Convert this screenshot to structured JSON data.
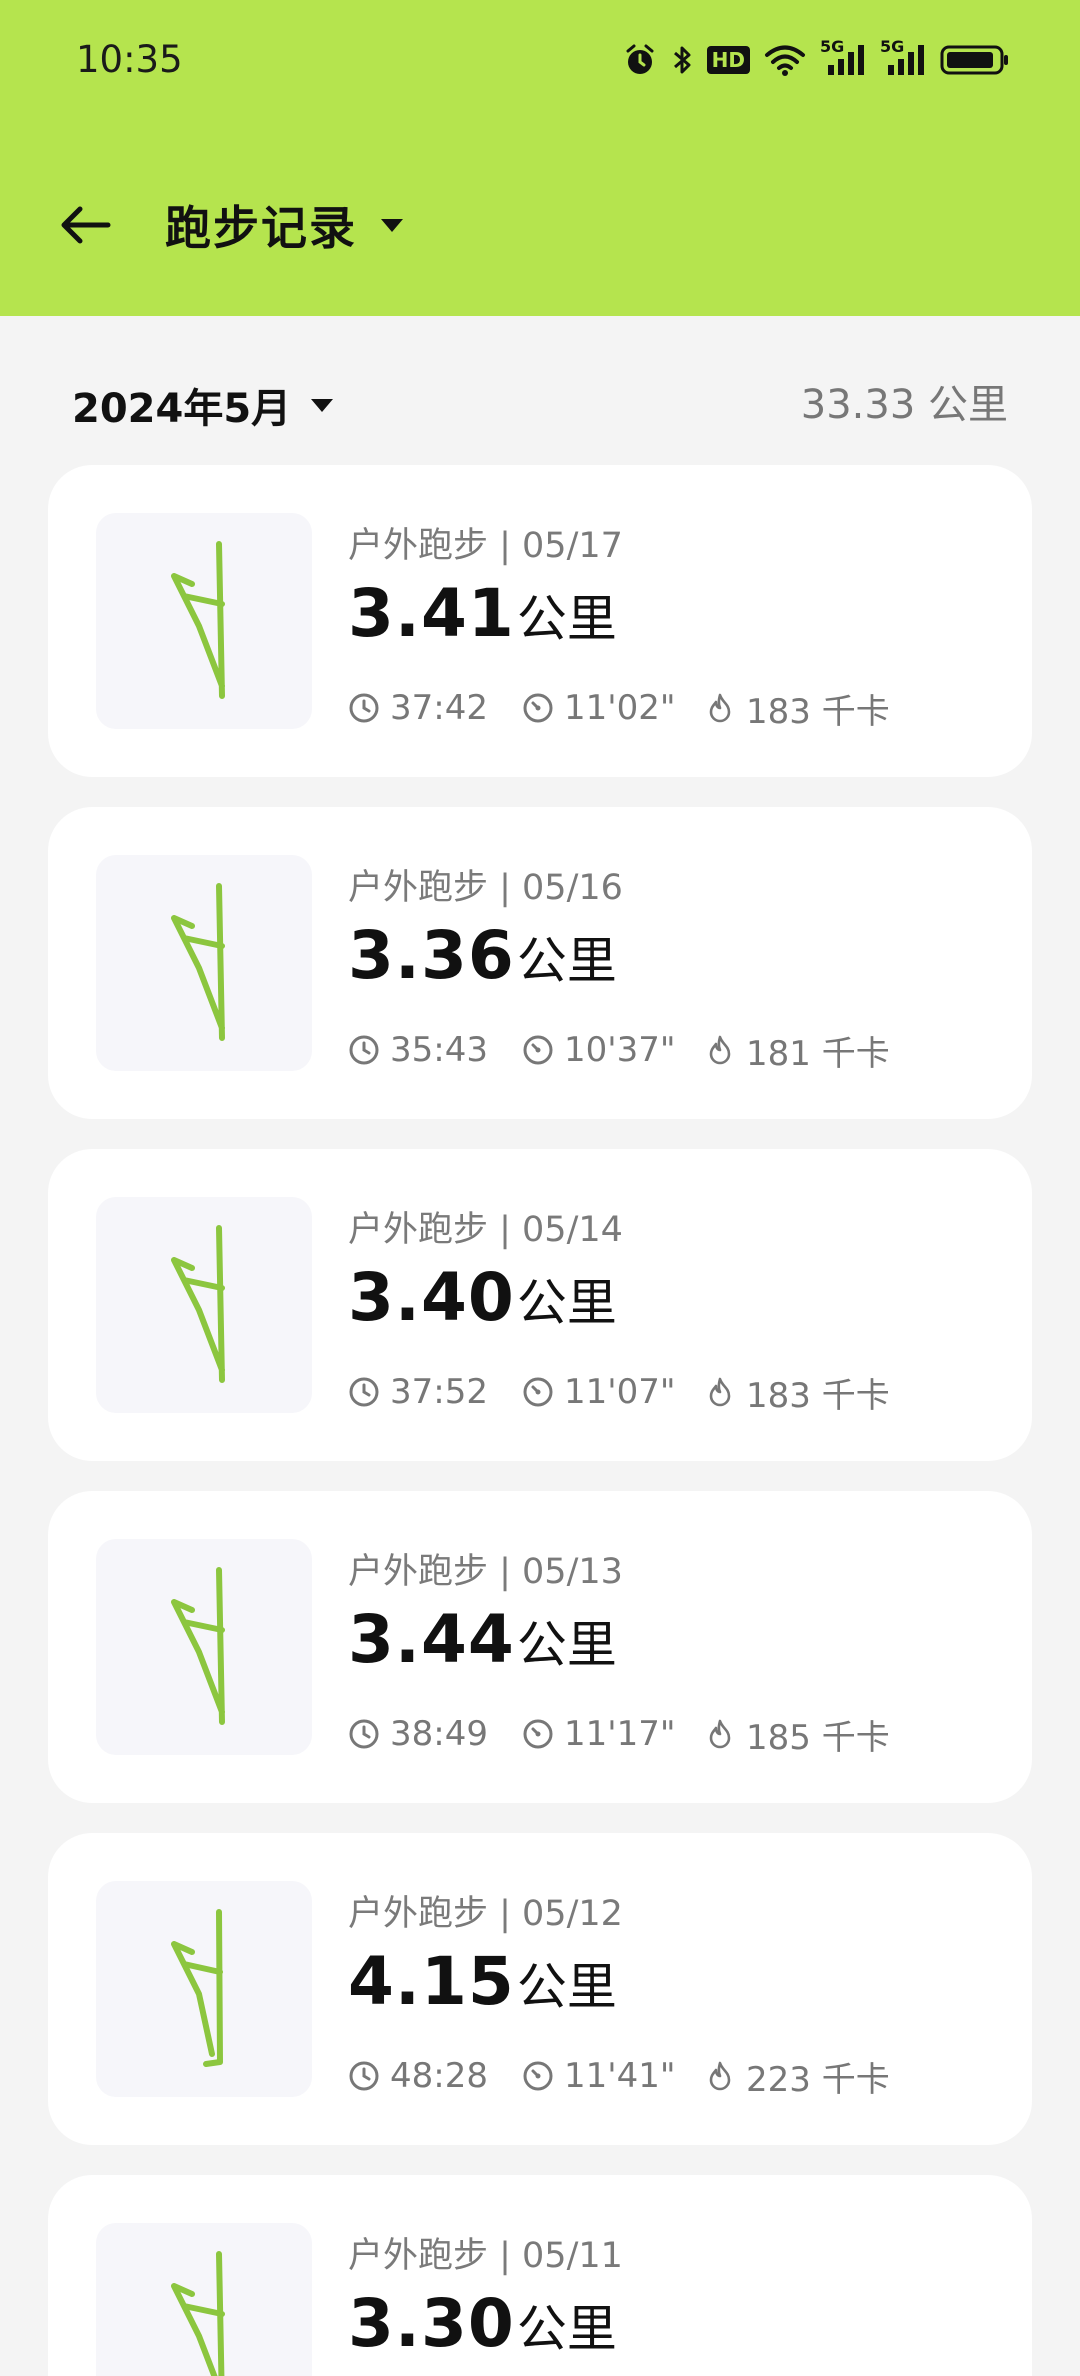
{
  "status_bar": {
    "time": "10:35",
    "hd_badge": "HD",
    "network_label_1": "5G",
    "network_label_2": "5G"
  },
  "toolbar": {
    "title": "跑步记录"
  },
  "summary": {
    "month": "2024年5月",
    "total_distance": "33.33 公里"
  },
  "colors": {
    "accent": "#b5e44e",
    "route": "#8cc63f"
  },
  "records": [
    {
      "type_date": "户外跑步 | 05/17",
      "distance": "3.41",
      "unit": "公里",
      "duration": "37:42",
      "pace": "11'02\"",
      "calories": "183 千卡"
    },
    {
      "type_date": "户外跑步 | 05/16",
      "distance": "3.36",
      "unit": "公里",
      "duration": "35:43",
      "pace": "10'37\"",
      "calories": "181 千卡"
    },
    {
      "type_date": "户外跑步 | 05/14",
      "distance": "3.40",
      "unit": "公里",
      "duration": "37:52",
      "pace": "11'07\"",
      "calories": "183 千卡"
    },
    {
      "type_date": "户外跑步 | 05/13",
      "distance": "3.44",
      "unit": "公里",
      "duration": "38:49",
      "pace": "11'17\"",
      "calories": "185 千卡"
    },
    {
      "type_date": "户外跑步 | 05/12",
      "distance": "4.15",
      "unit": "公里",
      "duration": "48:28",
      "pace": "11'41\"",
      "calories": "223 千卡"
    },
    {
      "type_date": "户外跑步 | 05/11",
      "distance": "3.30",
      "unit": "公里",
      "duration": "",
      "pace": "",
      "calories": ""
    }
  ],
  "icons": {
    "back": "arrow-left-icon",
    "duration": "clock-icon",
    "pace": "speedometer-icon",
    "calories": "flame-icon"
  }
}
